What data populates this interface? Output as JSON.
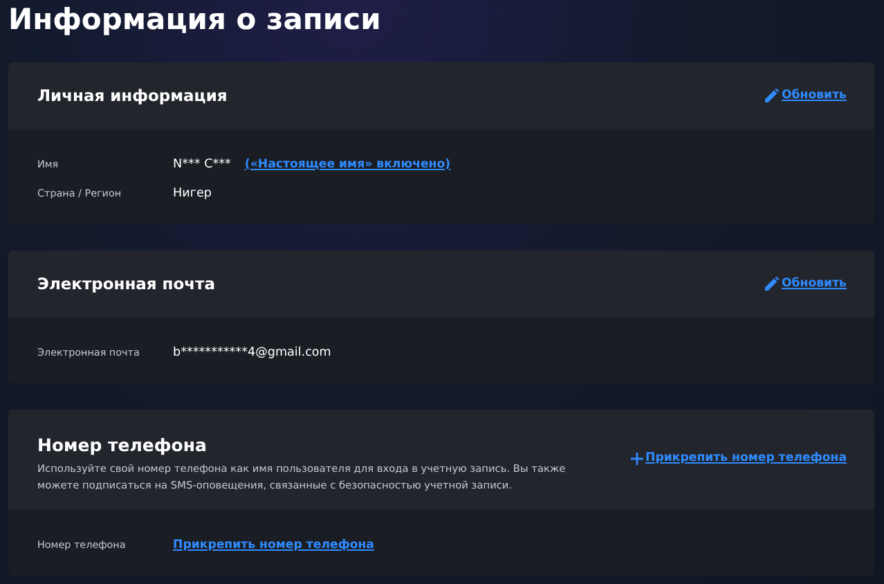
{
  "page_title": "Информация о записи",
  "sections": [
    {
      "title": "Личная информация",
      "action": {
        "kind": "edit",
        "label": "Обновить"
      },
      "rows": [
        {
          "label": "Имя",
          "kind": "text",
          "value": "N*** C***",
          "note": "(«Настоящее имя» включено)"
        },
        {
          "label": "Страна / Регион",
          "kind": "text",
          "value": "Нигер"
        }
      ]
    },
    {
      "title": "Электронная почта",
      "action": {
        "kind": "edit",
        "label": "Обновить"
      },
      "rows": [
        {
          "label": "Электронная почта",
          "kind": "text",
          "value": "b***********4@gmail.com"
        }
      ]
    },
    {
      "title": "Номер телефона",
      "description": "Используйте свой номер телефона как имя пользователя для входа в учетную запись. Вы также можете подписаться на SMS-оповещения, связанные с безопасностью учетной записи.",
      "action": {
        "kind": "add",
        "label": "Прикрепить номер телефона"
      },
      "rows": [
        {
          "label": "Номер телефона",
          "kind": "link",
          "value": "Прикрепить номер телефона"
        }
      ]
    }
  ]
}
